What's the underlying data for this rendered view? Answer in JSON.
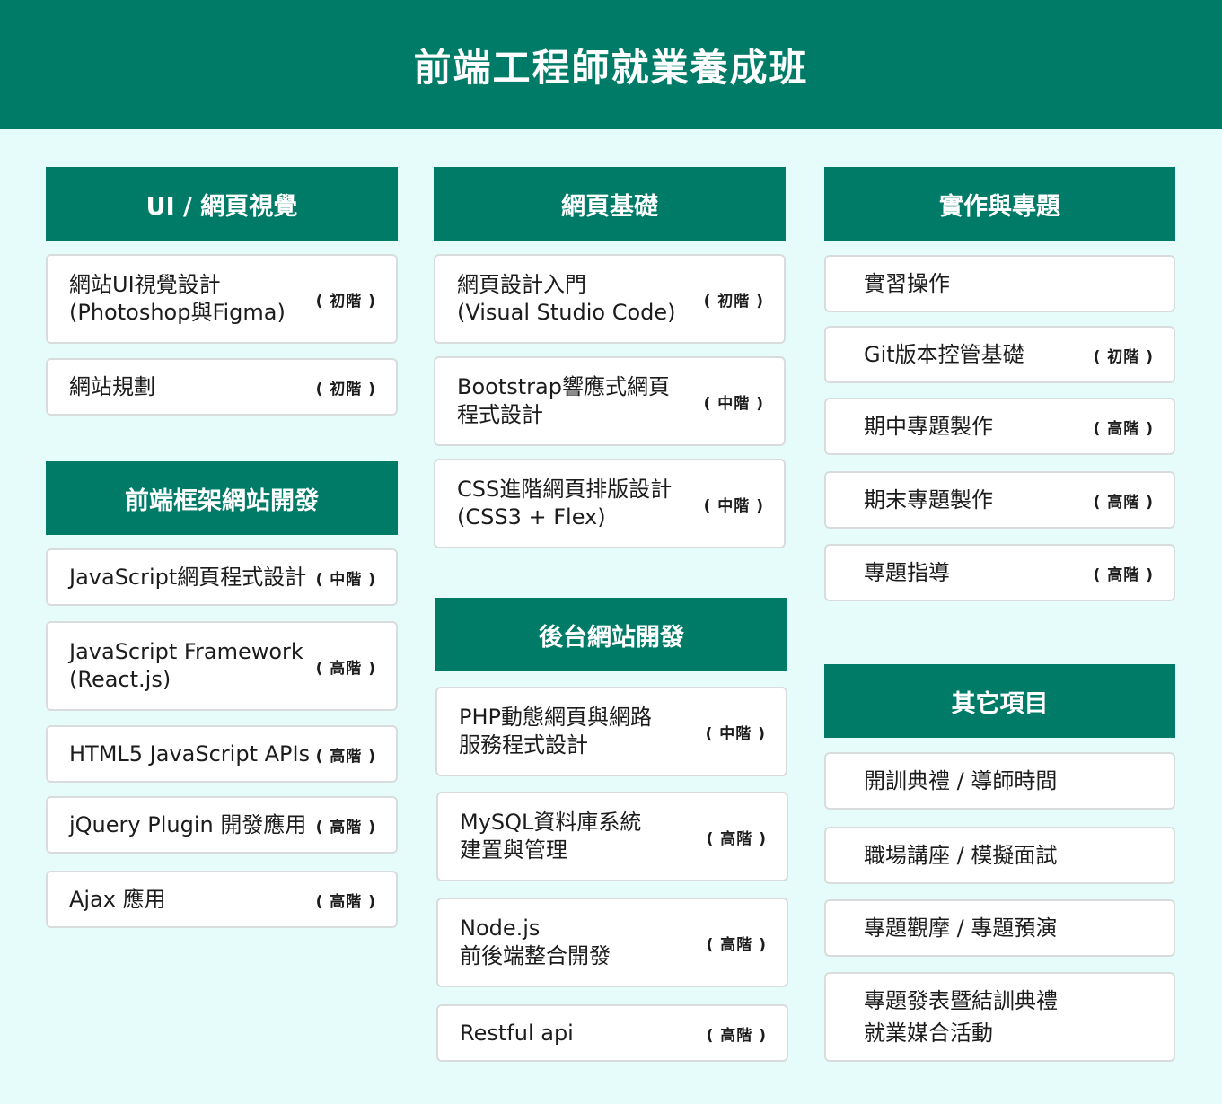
{
  "page_title": "前端工程師就業養成班",
  "colors": {
    "primary": "#007b67",
    "background": "#e6fcfb",
    "card": "#ffffff"
  },
  "column1": {
    "section1": {
      "header": "UI / 網頁視覺",
      "items": [
        {
          "title": "網站UI視覺設計\n(Photoshop與Figma)",
          "level": "( 初階 )"
        },
        {
          "title": "網站規劃",
          "level": "( 初階 )"
        }
      ]
    },
    "section2": {
      "header": "前端框架網站開發",
      "items": [
        {
          "title": "JavaScript網頁程式設計",
          "level": "( 中階 )"
        },
        {
          "title": "JavaScript Framework\n(React.js)",
          "level": "( 高階 )"
        },
        {
          "title": "HTML5 JavaScript APIs",
          "level": "( 高階 )"
        },
        {
          "title": "jQuery Plugin 開發應用",
          "level": "( 高階 )"
        },
        {
          "title": "Ajax 應用",
          "level": "( 高階 )"
        }
      ]
    }
  },
  "column2": {
    "section1": {
      "header": "網頁基礎",
      "items": [
        {
          "title": "網頁設計入門\n(Visual Studio Code)",
          "level": "( 初階 )"
        },
        {
          "title": "Bootstrap響應式網頁\n程式設計",
          "level": "( 中階 )"
        },
        {
          "title": "CSS進階網頁排版設計\n(CSS3 + Flex)",
          "level": "( 中階 )"
        }
      ]
    },
    "section2": {
      "header": "後台網站開發",
      "items": [
        {
          "title": "PHP動態網頁與網路\n服務程式設計",
          "level": "( 中階 )"
        },
        {
          "title": "MySQL資料庫系統\n建置與管理",
          "level": "( 高階 )"
        },
        {
          "title": "Node.js\n前後端整合開發",
          "level": "( 高階 )"
        },
        {
          "title": "Restful api",
          "level": "( 高階 )"
        }
      ]
    }
  },
  "column3": {
    "section1": {
      "header": "實作與專題",
      "items": [
        {
          "title": "實習操作",
          "level": ""
        },
        {
          "title": "Git版本控管基礎",
          "level": "( 初階 )"
        },
        {
          "title": "期中專題製作",
          "level": "( 高階 )"
        },
        {
          "title": "期末專題製作",
          "level": "( 高階 )"
        },
        {
          "title": "專題指導",
          "level": "( 高階 )"
        }
      ]
    },
    "section2": {
      "header": "其它項目",
      "items": [
        {
          "title": "開訓典禮 / 導師時間",
          "level": ""
        },
        {
          "title": "職場講座 / 模擬面試",
          "level": ""
        },
        {
          "title": "專題觀摩 / 專題預演",
          "level": ""
        },
        {
          "title": "專題發表暨結訓典禮\n就業媒合活動",
          "level": ""
        }
      ]
    }
  }
}
